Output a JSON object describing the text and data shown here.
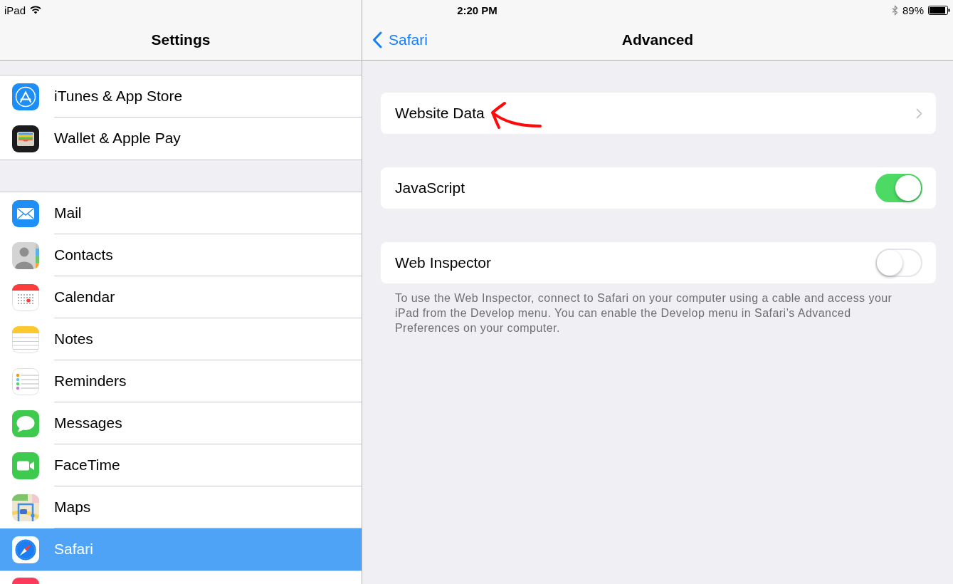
{
  "status_bar": {
    "device": "iPad",
    "time": "2:20 PM",
    "battery": "89%"
  },
  "sidebar": {
    "title": "Settings",
    "groups": [
      {
        "items": [
          {
            "label": "iTunes & App Store",
            "selected": false
          },
          {
            "label": "Wallet & Apple Pay",
            "selected": false
          }
        ]
      },
      {
        "items": [
          {
            "label": "Mail",
            "selected": false
          },
          {
            "label": "Contacts",
            "selected": false
          },
          {
            "label": "Calendar",
            "selected": false
          },
          {
            "label": "Notes",
            "selected": false
          },
          {
            "label": "Reminders",
            "selected": false
          },
          {
            "label": "Messages",
            "selected": false
          },
          {
            "label": "FaceTime",
            "selected": false
          },
          {
            "label": "Maps",
            "selected": false
          },
          {
            "label": "Safari",
            "selected": true
          }
        ]
      }
    ]
  },
  "detail": {
    "back_label": "Safari",
    "title": "Advanced",
    "sections": [
      {
        "rows": [
          {
            "kind": "link",
            "label": "Website Data",
            "annotated": true
          }
        ]
      },
      {
        "rows": [
          {
            "kind": "switch",
            "label": "JavaScript",
            "on": true,
            "annotated": false
          }
        ]
      },
      {
        "rows": [
          {
            "kind": "switch",
            "label": "Web Inspector",
            "on": false,
            "annotated": false
          }
        ],
        "footer": "To use the Web Inspector, connect to Safari on your computer using a cable and access your iPad from the Develop menu. You can enable the Develop menu in Safari’s Advanced Preferences on your computer."
      }
    ]
  }
}
